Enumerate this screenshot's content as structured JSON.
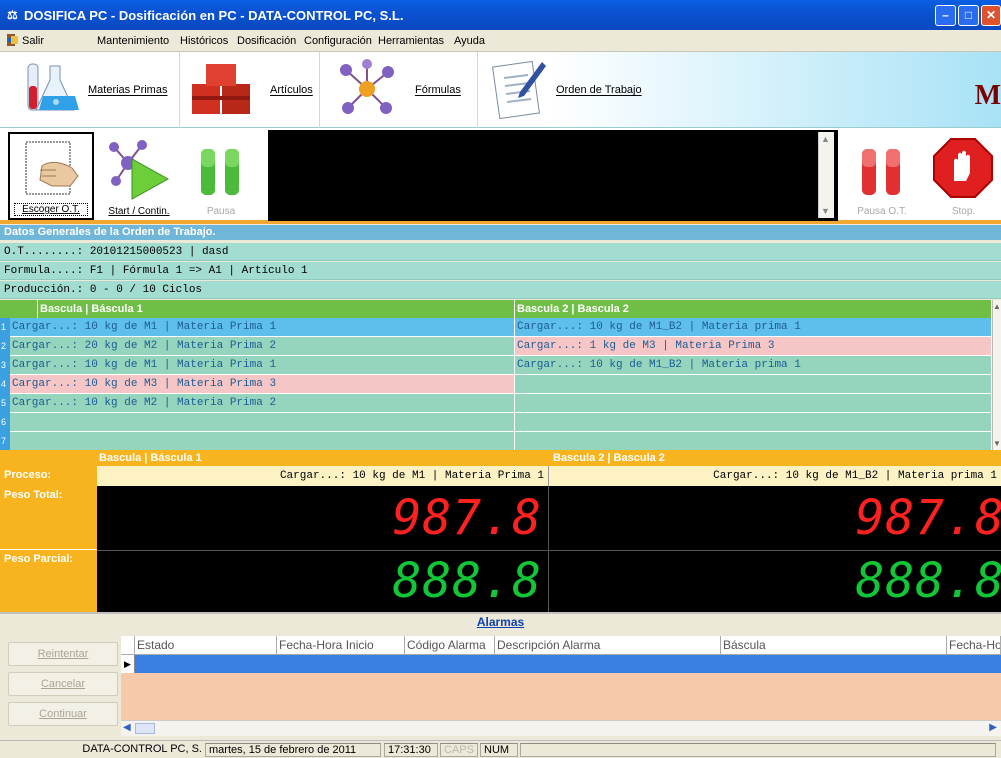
{
  "window": {
    "title": "DOSIFICA PC - Dosificación en PC - DATA-CONTROL PC, S.L.",
    "controls": {
      "minimize": "–",
      "maximize": "□",
      "close": "✕"
    }
  },
  "menu": {
    "exit": "Salir",
    "items": [
      "Mantenimiento",
      "Históricos",
      "Dosificación",
      "Configuración",
      "Herramientas",
      "Ayuda"
    ]
  },
  "nav": {
    "items": [
      {
        "label": "Materias Primas",
        "icon": "flasks-icon"
      },
      {
        "label": "Artículos",
        "icon": "boxes-icon"
      },
      {
        "label": "Fórmulas",
        "icon": "molecule-icon"
      },
      {
        "label": "Orden de Trabajo",
        "icon": "document-pen-icon"
      }
    ],
    "brand": "M"
  },
  "controls": {
    "choose_ot": "Escoger O.T.",
    "start": "Start / Contin.",
    "pause": "Pausa",
    "pause_ot": "Pausa O.T.",
    "stop": "Stop."
  },
  "order": {
    "section_title": "Datos Generales de la Orden de Trabajo.",
    "ot_line": "O.T........: 20101215000523 | dasd",
    "formula_line": "Formula....: F1 | Fórmula 1 => A1 | Artículo 1",
    "production_line": "Producción.: 0 - 0 / 10 Ciclos"
  },
  "grid": {
    "col1_header": "Bascula | Báscula 1",
    "col2_header": "Bascula 2 | Bascula 2",
    "rows": [
      {
        "num": "1",
        "c1": "Cargar...: 10 kg de M1 | Materia Prima 1",
        "c2": "Cargar...: 10 kg de M1_B2 | Materia prima 1"
      },
      {
        "num": "2",
        "c1": "Cargar...: 20 kg de M2 | Materia Prima 2",
        "c2": "Cargar...: 1 kg de M3 | Materia Prima 3"
      },
      {
        "num": "3",
        "c1": "Cargar...: 10 kg de M1 | Materia Prima 1",
        "c2": "Cargar...: 10 kg de M1_B2 | Materia prima 1"
      },
      {
        "num": "4",
        "c1": "Cargar...: 10 kg de M3 | Materia Prima 3",
        "c2": ""
      },
      {
        "num": "5",
        "c1": "Cargar...: 10 kg de M2 | Materia Prima 2",
        "c2": ""
      },
      {
        "num": "6",
        "c1": "",
        "c2": ""
      },
      {
        "num": "7",
        "c1": "",
        "c2": ""
      }
    ],
    "colors": {
      "selected": "#5ec0ea",
      "pending": "#f6c6c6",
      "normal": "#95d5bd"
    }
  },
  "scales": {
    "header1": "Bascula | Báscula 1",
    "header2": "Bascula 2 | Bascula 2",
    "proceso_label": "Proceso:",
    "proceso1": "Cargar...: 10 kg de M1 | Materia Prima 1",
    "proceso2": "Cargar...: 10 kg de M1_B2 | Materia prima 1",
    "peso_total_label": "Peso Total:",
    "peso_total1": "987.8",
    "peso_total2": "987.8",
    "peso_parcial_label": "Peso Parcial:",
    "peso_parcial1": "888.8",
    "peso_parcial2": "888.8"
  },
  "alarms": {
    "title": "Alarmas",
    "buttons": {
      "retry": "Reintentar",
      "cancel": "Cancelar",
      "continue": "Continuar"
    },
    "columns": [
      "Estado",
      "Fecha-Hora Inicio",
      "Código Alarma",
      "Descripción Alarma",
      "Báscula",
      "Fecha-Ho"
    ]
  },
  "status": {
    "company": "DATA-CONTROL PC, S.",
    "date": "martes, 15 de febrero de 2011",
    "time": "17:31:30",
    "caps": "CAPS",
    "num": "NUM"
  }
}
